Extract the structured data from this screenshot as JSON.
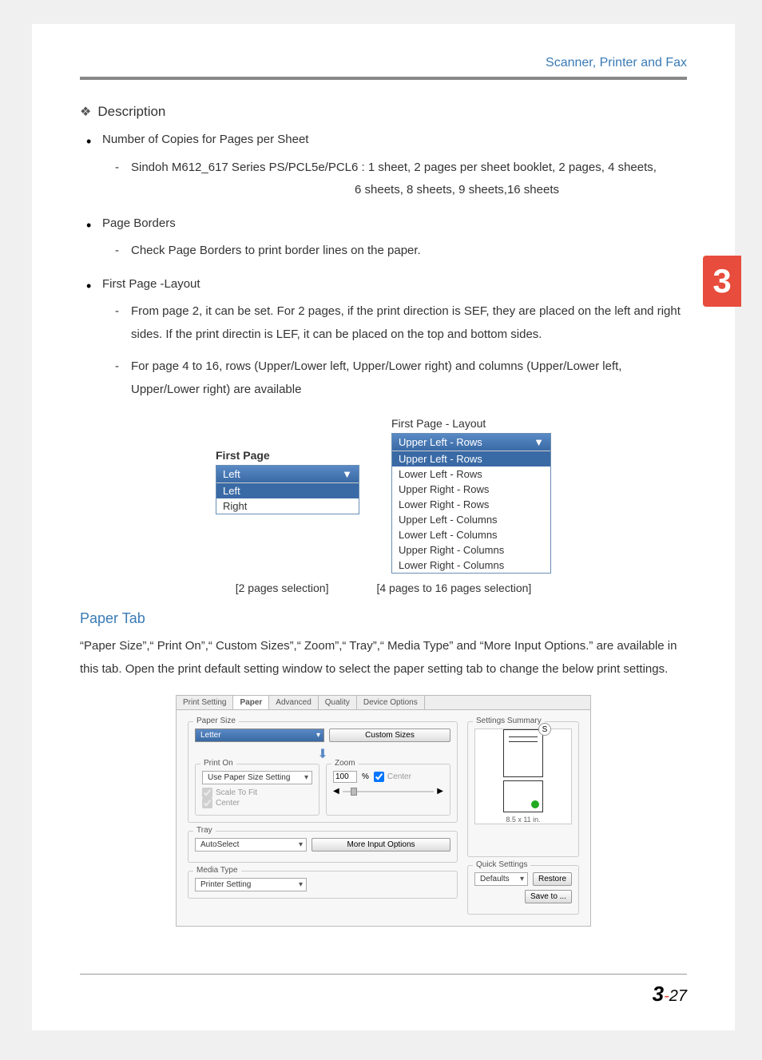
{
  "header": {
    "title": "Scanner, Printer and Fax"
  },
  "chapter_tab": "3",
  "description": {
    "heading": "Description",
    "items": [
      {
        "title": "Number of Copies for Pages per Sheet",
        "sub": [
          "Sindoh M612_617 Series PS/PCL5e/PCL6 : 1 sheet, 2 pages per sheet booklet, 2 pages, 4 sheets,",
          "6 sheets, 8 sheets, 9 sheets,16 sheets"
        ]
      },
      {
        "title": "Page Borders",
        "sub": [
          "Check Page Borders to print border lines on the paper."
        ]
      },
      {
        "title": "First Page -Layout",
        "sub": [
          "From page 2, it can be set. For 2 pages, if the print direction is SEF, they are placed on the left and right sides. If the print directin is LEF, it can be placed on the top and bottom sides.",
          "For page 4 to 16, rows (Upper/Lower left, Upper/Lower right) and columns (Upper/Lower left, Upper/Lower right) are available"
        ]
      }
    ]
  },
  "dropdown1": {
    "label": "First Page",
    "selected": "Left",
    "options": [
      "Left",
      "Right"
    ]
  },
  "dropdown2": {
    "label": "First Page - Layout",
    "selected": "Upper Left - Rows",
    "options": [
      "Upper Left - Rows",
      "Lower Left - Rows",
      "Upper Right - Rows",
      "Lower Right - Rows",
      "Upper Left - Columns",
      "Lower Left - Columns",
      "Upper Right - Columns",
      "Lower Right - Columns"
    ]
  },
  "captions": {
    "left": "[2 pages  selection]",
    "right": "[4 pages to 16 pages selection]"
  },
  "paper_tab": {
    "heading": "Paper Tab",
    "body": "“Paper Size”,“ Print On”,“ Custom Sizes”,“ Zoom”,“ Tray”,“ Media Type” and “More Input Options.” are available in this tab. Open the print default setting window to select the paper setting tab to change the below print settings."
  },
  "dialog": {
    "tabs": [
      "Print Setting",
      "Paper",
      "Advanced",
      "Quality",
      "Device Options"
    ],
    "active_tab": "Paper",
    "paper_size": {
      "legend": "Paper Size",
      "value": "Letter",
      "btn": "Custom Sizes"
    },
    "print_on": {
      "legend": "Print On",
      "value": "Use Paper Size Setting",
      "opts": [
        "Scale To Fit",
        "Center"
      ]
    },
    "zoom": {
      "legend": "Zoom",
      "value": "100",
      "unit": "%",
      "center": "Center"
    },
    "tray": {
      "legend": "Tray",
      "value": "AutoSelect",
      "btn": "More Input Options"
    },
    "media": {
      "legend": "Media Type",
      "value": "Printer Setting"
    },
    "summary": {
      "legend": "Settings Summary",
      "badge": "S",
      "dim": "8.5 x 11 in."
    },
    "quick": {
      "legend": "Quick Settings",
      "value": "Defaults",
      "restore": "Restore",
      "save": "Save to ..."
    }
  },
  "page_number": {
    "chapter": "3",
    "sep": "-",
    "page": "27"
  }
}
